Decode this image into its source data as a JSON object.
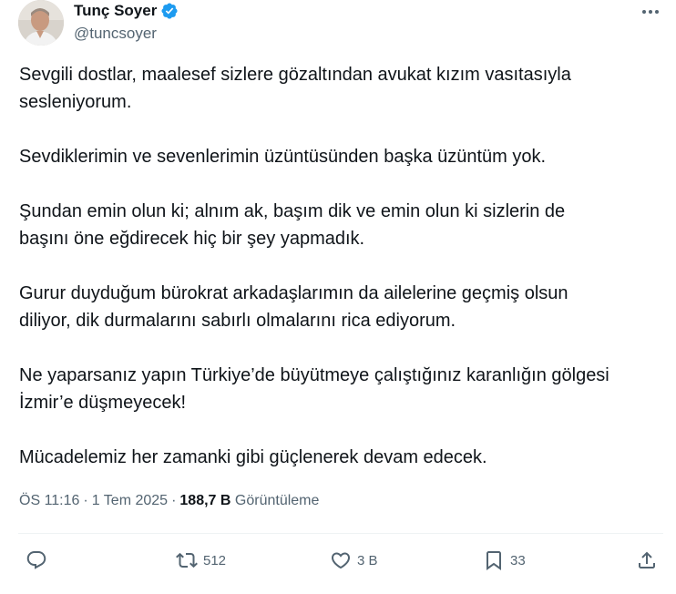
{
  "author": {
    "display_name": "Tunç Soyer",
    "handle": "@tuncsoyer",
    "verified": true
  },
  "icons": {
    "verified": "verified-badge-icon",
    "more": "more-options-icon",
    "reply": "reply-icon",
    "repost": "repost-icon",
    "like": "like-icon",
    "bookmark": "bookmark-icon",
    "share": "share-icon"
  },
  "colors": {
    "text": "#0f1419",
    "secondary": "#536471",
    "verified": "#1d9bf0",
    "divider": "#eff3f4"
  },
  "tweet": {
    "paragraphs": [
      "Sevgili dostlar, maalesef sizlere gözaltından avukat kızım vasıtasıyla\nsesleniyorum.",
      "Sevdiklerimin ve sevenlerimin üzüntüsünden başka üzüntüm yok.",
      "Şundan emin olun ki; alnım ak, başım dik ve emin olun ki sizlerin de\nbaşını öne eğdirecek hiç bir şey yapmadık.",
      "Gurur duyduğum bürokrat arkadaşlarımın da ailelerine geçmiş olsun\ndiliyor, dik durmalarını sabırlı olmalarını rica ediyorum.",
      "Ne yaparsanız yapın Türkiye’de büyütmeye çalıştığınız karanlığın gölgesi\nİzmir’e düşmeyecek!",
      "Mücadelemiz her zamanki gibi güçlenerek devam edecek."
    ]
  },
  "meta": {
    "time": "ÖS 11:16",
    "separator": "·",
    "date": "1 Tem 2025",
    "views_count": "188,7 B",
    "views_label": "Görüntüleme"
  },
  "actions": {
    "reposts": "512",
    "likes": "3 B",
    "bookmarks": "33"
  }
}
